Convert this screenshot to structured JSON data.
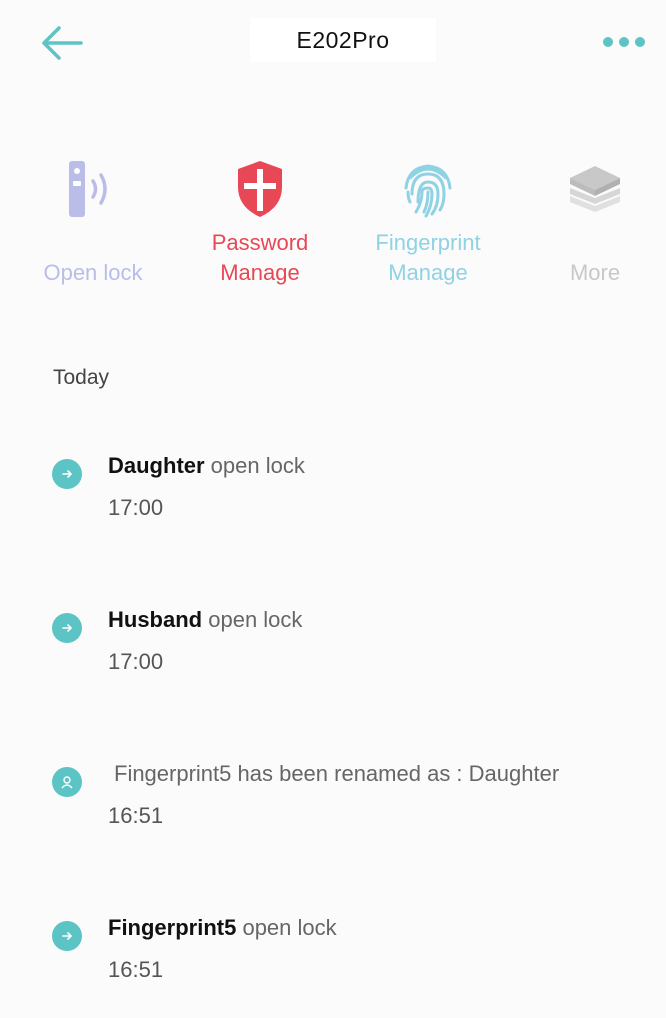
{
  "header": {
    "title": "E202Pro",
    "back_icon": "arrow-left-icon",
    "more_icon": "more-dots-icon",
    "accent_color": "#5cc4c4"
  },
  "actions": [
    {
      "label": "Open lock",
      "icon": "remote-signal-icon",
      "color": "#b9bde8"
    },
    {
      "label": "Password\nManage",
      "icon": "shield-icon",
      "color": "#e84855"
    },
    {
      "label": "Fingerprint\nManage",
      "icon": "fingerprint-icon",
      "color": "#8fd2e4"
    },
    {
      "label": "More",
      "icon": "layers-icon",
      "color": "#c8c8c8"
    }
  ],
  "section": {
    "label": "Today"
  },
  "logs": [
    {
      "actor": "Daughter",
      "action": " open lock",
      "time": "17:00",
      "icon": "unlock-record-icon"
    },
    {
      "actor": "Husband",
      "action": " open lock",
      "time": "17:00",
      "icon": "unlock-record-icon"
    },
    {
      "actor": "",
      "action": "Fingerprint5 has been renamed as : Daughter",
      "time": "16:51",
      "icon": "user-record-icon"
    },
    {
      "actor": "Fingerprint5",
      "action": " open lock",
      "time": "16:51",
      "icon": "unlock-record-icon"
    }
  ],
  "colors": {
    "log_icon": "#5cc4c4"
  }
}
